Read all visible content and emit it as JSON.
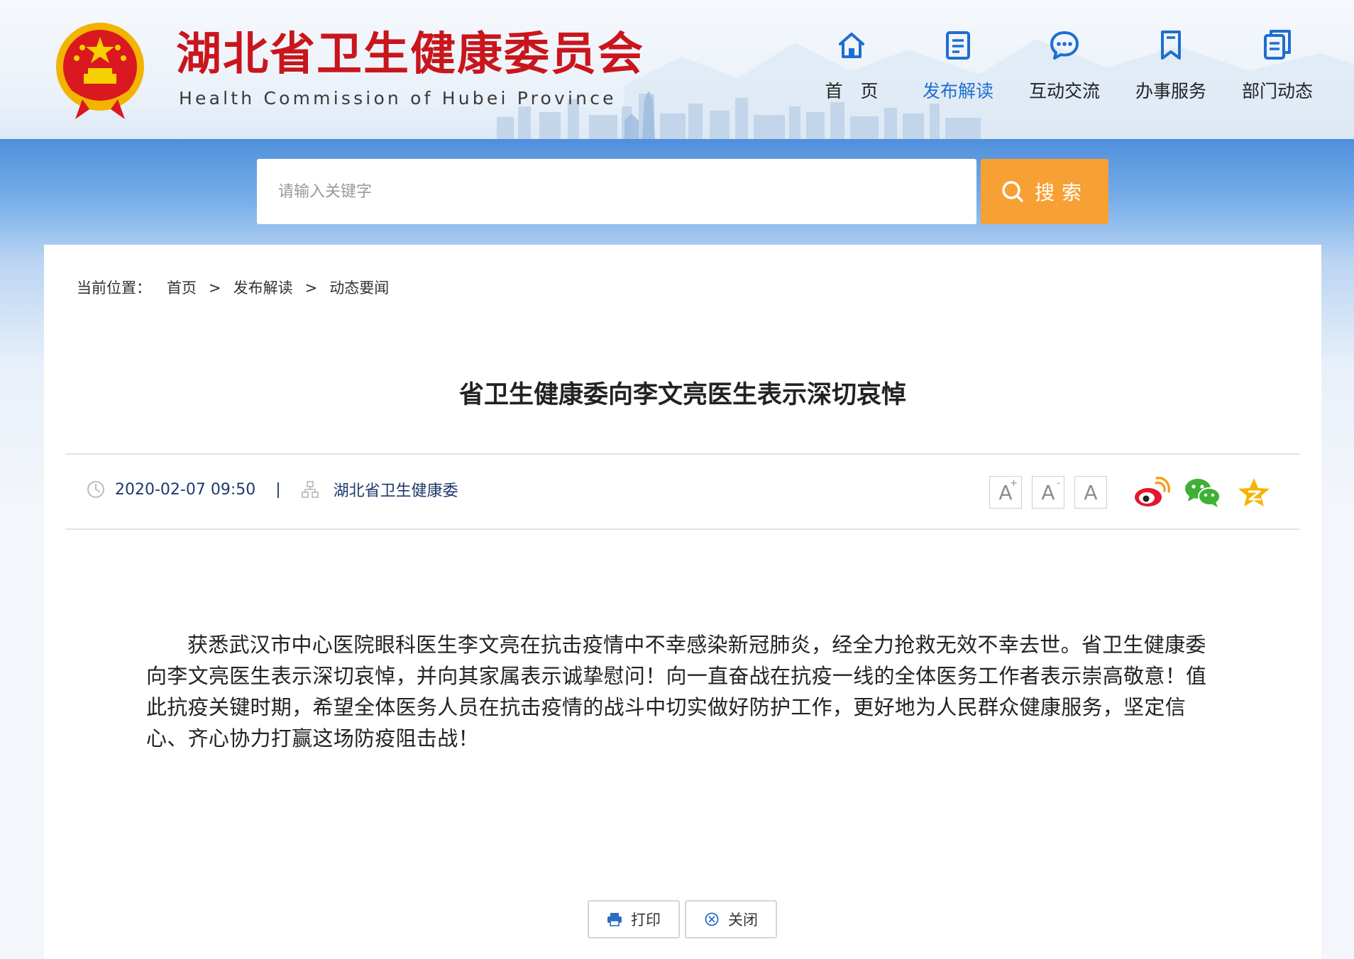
{
  "header": {
    "title": "湖北省卫生健康委员会",
    "subtitle": "Health Commission of Hubei Province",
    "nav": [
      {
        "label": "首　页",
        "icon": "home-icon",
        "active": false
      },
      {
        "label": "发布解读",
        "icon": "document-icon",
        "active": true
      },
      {
        "label": "互动交流",
        "icon": "chat-bubble-icon",
        "active": false
      },
      {
        "label": "办事服务",
        "icon": "bookmark-icon",
        "active": false
      },
      {
        "label": "部门动态",
        "icon": "copy-pages-icon",
        "active": false
      }
    ]
  },
  "search": {
    "placeholder": "请输入关键字",
    "value": "",
    "button_label": "搜索"
  },
  "breadcrumb": {
    "lead": "当前位置：",
    "items": [
      "首页",
      "发布解读",
      "动态要闻"
    ],
    "separator": ">"
  },
  "article": {
    "title": "省卫生健康委向李文亮医生表示深切哀悼",
    "date": "2020-02-07 09:50",
    "divider": "|",
    "source": "湖北省卫生健康委",
    "body": "获悉武汉市中心医院眼科医生李文亮在抗击疫情中不幸感染新冠肺炎，经全力抢救无效不幸去世。省卫生健康委向李文亮医生表示深切哀悼，并向其家属表示诚挚慰问！向一直奋战在抗疫一线的全体医务工作者表示崇高敬意！值此抗疫关键时期，希望全体医务人员在抗击疫情的战斗中切实做好防护工作，更好地为人民群众健康服务，坚定信心、齐心协力打赢这场防疫阻击战！"
  },
  "font_tools": {
    "larger": "A",
    "larger_mark": "+",
    "smaller": "A",
    "smaller_mark": "-",
    "default": "A"
  },
  "share": [
    "weibo-icon",
    "wechat-icon",
    "qzone-icon"
  ],
  "actions": {
    "print_label": "打印",
    "close_label": "关闭"
  },
  "colors": {
    "brand_red": "#c9161d",
    "nav_active": "#1e6ed0",
    "search_button": "#f7a033",
    "meta_text": "#1f3a6b",
    "weibo": "#e6162d",
    "wechat": "#3fb036",
    "qzone": "#f5b400"
  }
}
